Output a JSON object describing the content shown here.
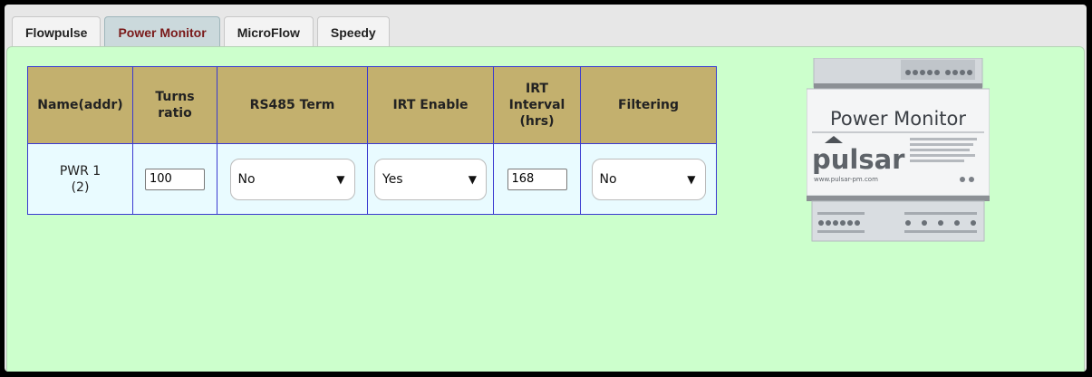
{
  "tabs": [
    {
      "label": "Flowpulse"
    },
    {
      "label": "Power Monitor"
    },
    {
      "label": "MicroFlow"
    },
    {
      "label": "Speedy"
    }
  ],
  "table": {
    "headers": {
      "name": "Name(addr)",
      "turns_line1": "Turns",
      "turns_line2": "ratio",
      "rs485": "RS485 Term",
      "irt_enable": "IRT Enable",
      "irt_interval_line1": "IRT",
      "irt_interval_line2": "Interval",
      "irt_interval_line3": "(hrs)",
      "filtering": "Filtering"
    },
    "row": {
      "name_line1": "PWR 1",
      "name_line2": "(2)",
      "turns_ratio": "100",
      "rs485_term": "No",
      "irt_enable": "Yes",
      "irt_interval": "168",
      "filtering": "No"
    }
  },
  "device": {
    "title": "Power Monitor",
    "brand": "pulsar",
    "website": "www.pulsar-pm.com"
  },
  "colors": {
    "panel_bg": "#ccffcc",
    "header_bg": "#c3b06e",
    "table_border": "#3a3ad0",
    "active_tab_text": "#7a1a1a"
  }
}
